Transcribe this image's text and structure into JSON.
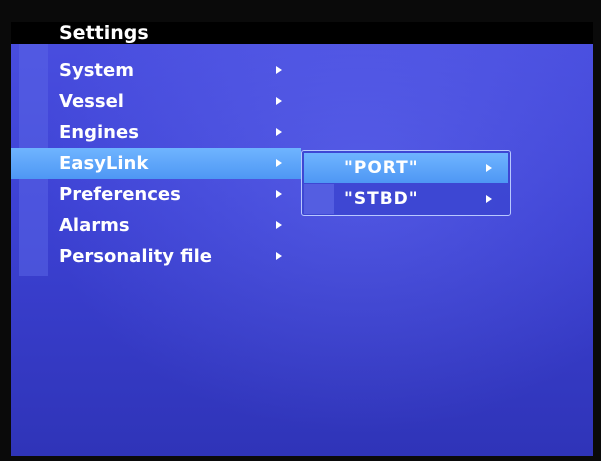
{
  "header": {
    "title": "Settings"
  },
  "menu": {
    "items": [
      {
        "label": "System",
        "selected": false
      },
      {
        "label": "Vessel",
        "selected": false
      },
      {
        "label": "Engines",
        "selected": false
      },
      {
        "label": "EasyLink",
        "selected": true
      },
      {
        "label": "Preferences",
        "selected": false
      },
      {
        "label": "Alarms",
        "selected": false
      },
      {
        "label": "Personality file",
        "selected": false
      }
    ]
  },
  "submenu": {
    "items": [
      {
        "label": "\"PORT\"",
        "selected": true
      },
      {
        "label": "\"STBD\"",
        "selected": false
      }
    ]
  },
  "colors": {
    "background": "#3c41d3",
    "selection": "#5aa6ff",
    "text": "#ffffff"
  },
  "icons": {
    "submenu_indicator": "right-arrow-icon"
  }
}
